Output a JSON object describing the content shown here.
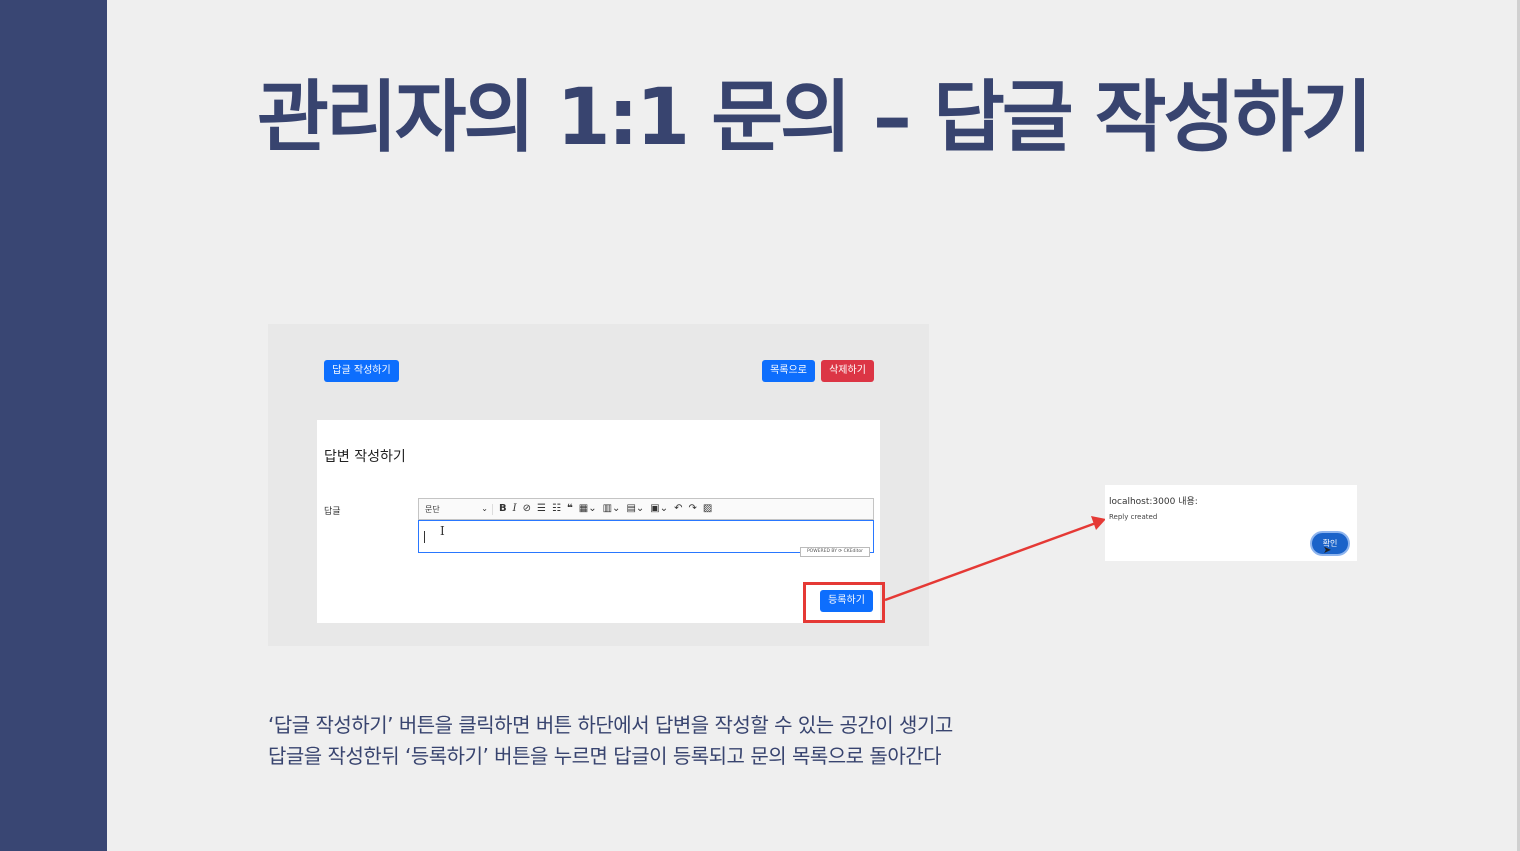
{
  "slide": {
    "title": "관리자의 1:1 문의 – 답글 작성하기",
    "description_line1": "‘답글 작성하기’ 버튼을 클릭하면 버튼 하단에서 답변을 작성할 수 있는 공간이 생기고",
    "description_line2": "답글을 작성한뒤 ‘등록하기’ 버튼을 누르면 답글이 등록되고 문의 목록으로 돌아간다",
    "colors": {
      "sidebar": "#394673",
      "title": "#38446f",
      "highlight": "#e53935"
    }
  },
  "screenshot": {
    "write_reply_button": "답글 작성하기",
    "to_list_button": "목록으로",
    "delete_button": "삭제하기",
    "card_title": "답변 작성하기",
    "reply_label": "답글",
    "editor": {
      "paragraph_select": "문단",
      "toolbar_icons": [
        "bold-icon",
        "italic-icon",
        "link-icon",
        "bulleted-list-icon",
        "numbered-list-icon",
        "blockquote-icon",
        "table-icon",
        "column-icon",
        "row-icon",
        "merge-cells-icon",
        "undo-icon",
        "redo-icon",
        "image-upload-icon"
      ],
      "powered_by": "POWERED BY ⟳ CKEditor"
    },
    "register_button": "등록하기"
  },
  "alert": {
    "title": "localhost:3000 내용:",
    "message": "Reply created",
    "ok_button": "확인"
  }
}
